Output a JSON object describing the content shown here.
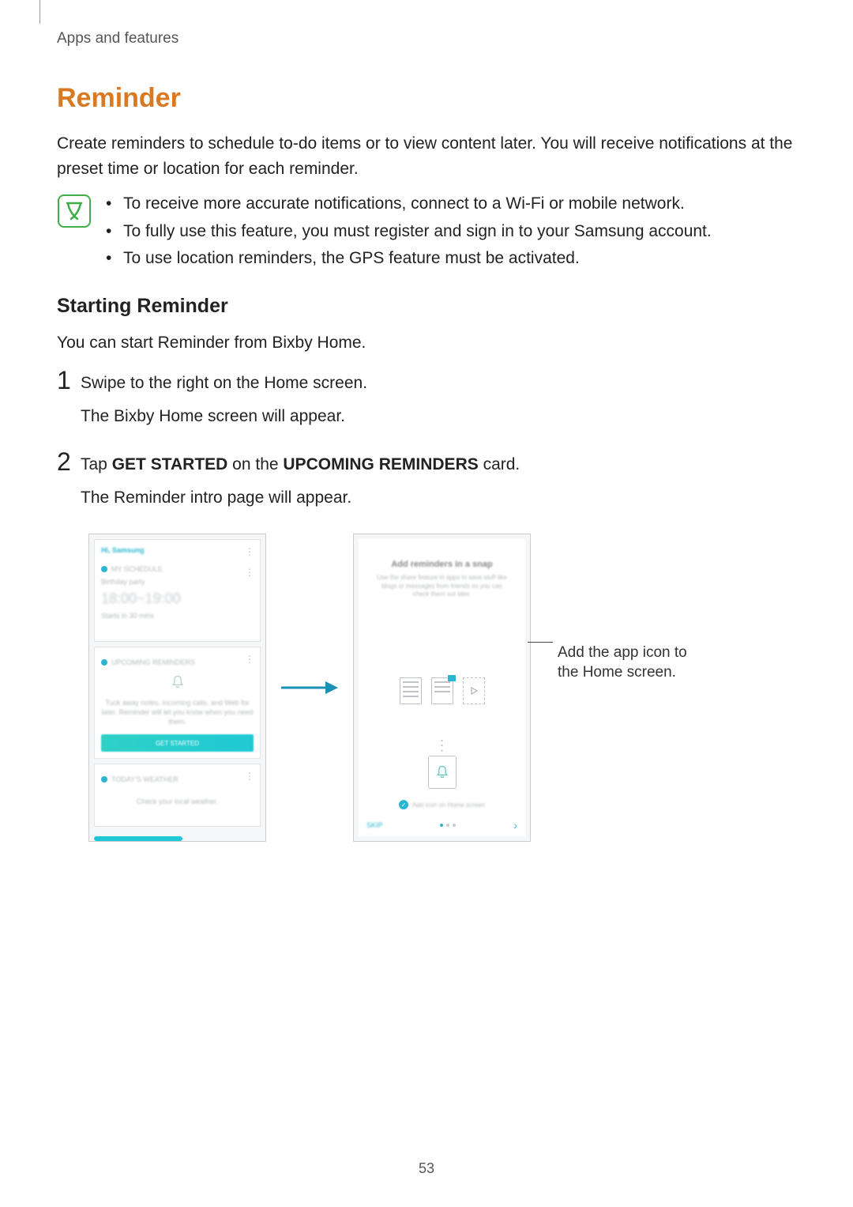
{
  "header": "Apps and features",
  "section_title": "Reminder",
  "intro": "Create reminders to schedule to-do items or to view content later. You will receive notifications at the preset time or location for each reminder.",
  "notes": [
    "To receive more accurate notifications, connect to a Wi-Fi or mobile network.",
    "To fully use this feature, you must register and sign in to your Samsung account.",
    "To use location reminders, the GPS feature must be activated."
  ],
  "subsection_title": "Starting Reminder",
  "subsection_intro": "You can start Reminder from Bixby Home.",
  "steps": [
    {
      "number": "1",
      "main": "Swipe to the right on the Home screen.",
      "sub": "The Bixby Home screen will appear."
    },
    {
      "number": "2",
      "main_prefix": "Tap ",
      "bold1": "GET STARTED",
      "mid": " on the ",
      "bold2": "UPCOMING REMINDERS",
      "suffix": " card.",
      "sub": "The Reminder intro page will appear."
    }
  ],
  "phone1": {
    "title": "Hi, Samsung",
    "event_name": "Birthday party",
    "time": "18:00~19:00",
    "button_label": "GET STARTED"
  },
  "phone2": {
    "heading": "Add reminders in a snap",
    "sub": "Use the share feature in apps to save stuff like blogs or messages from friends so you can check them out later.",
    "checkbox_label": "Add icon on Home screen",
    "skip": "SKIP"
  },
  "annotation": "Add the app icon to the Home screen.",
  "page_number": "53"
}
